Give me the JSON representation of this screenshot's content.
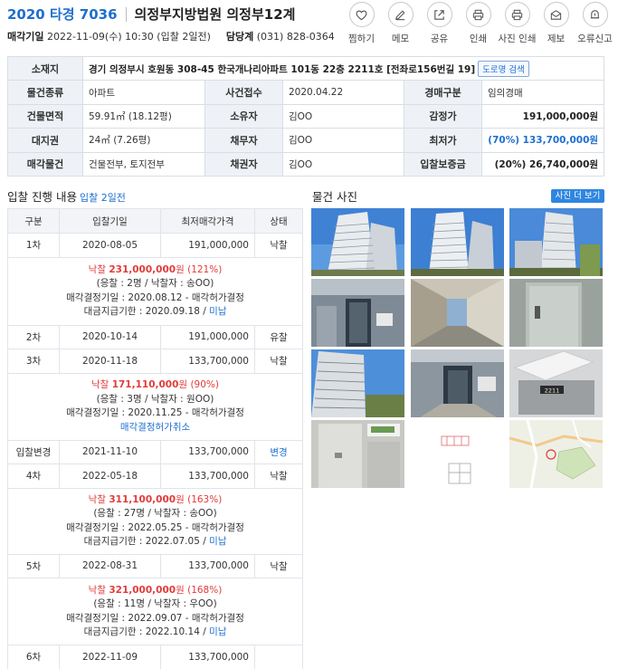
{
  "header": {
    "case_no": "2020 타경 7036",
    "court": "의정부지방법원 의정부12계",
    "date_label": "매각기일",
    "date_value": "2022-11-09(수) 10:30 (입찰 2일전)",
    "dept_label": "담당계",
    "dept_value": "(031) 828-0364"
  },
  "tools": [
    "찜하기",
    "메모",
    "공유",
    "인쇄",
    "사진 인쇄",
    "제보",
    "오류신고"
  ],
  "info": {
    "location_label": "소재지",
    "location_value": "경기 의정부시 호원동 308-45 한국개나리아파트 101동 22층 2211호 [전좌로156번길 19]",
    "road_btn": "도로명 검색",
    "type_label": "물건종류",
    "type_value": "아파트",
    "receipt_label": "사건접수",
    "receipt_value": "2020.04.22",
    "auction_type_label": "경매구분",
    "auction_type_value": "임의경매",
    "area_label": "건물면적",
    "area_value": "59.91㎡ (18.12평)",
    "owner_label": "소유자",
    "owner_value": "김OO",
    "appraisal_label": "감정가",
    "appraisal_value": "191,000,000원",
    "land_label": "대지권",
    "land_value": "24㎡ (7.26평)",
    "debtor_label": "채무자",
    "debtor_value": "김OO",
    "min_label": "최저가",
    "min_value": "(70%) 133,700,000원",
    "sale_label": "매각물건",
    "sale_value": "건물전부, 토지전부",
    "creditor_label": "채권자",
    "creditor_value": "김OO",
    "deposit_label": "입찰보증금",
    "deposit_value": "(20%) 26,740,000원"
  },
  "bid_section": {
    "title": "입찰 진행 내용",
    "sub": "입찰 2일전"
  },
  "bid_table": {
    "headers": [
      "구분",
      "입찰기일",
      "최저매각가격",
      "상태"
    ],
    "rows": [
      {
        "round": "1차",
        "date": "2020-08-05",
        "price": "191,000,000",
        "status": "낙찰"
      },
      {
        "round": "2차",
        "date": "2020-10-14",
        "price": "191,000,000",
        "status": "유찰"
      },
      {
        "round": "3차",
        "date": "2020-11-18",
        "price": "133,700,000",
        "status": "낙찰"
      },
      {
        "round": "입찰변경",
        "date": "2021-11-10",
        "price": "133,700,000",
        "status": "변경"
      },
      {
        "round": "4차",
        "date": "2022-05-18",
        "price": "133,700,000",
        "status": "낙찰"
      },
      {
        "round": "5차",
        "date": "2022-08-31",
        "price": "133,700,000",
        "status": "낙찰"
      },
      {
        "round": "6차",
        "date": "2022-11-09",
        "price": "133,700,000",
        "status": ""
      }
    ],
    "details": [
      {
        "prefix": "낙찰",
        "amount": "231,000,000",
        "won": "원",
        "rate": "(121%)",
        "bidders": "(응찰 : 2명 / 낙찰자 : 송OO)",
        "decision": "매각결정기일 : 2020.08.12 - 매각허가결정",
        "payment": "대금지급기한 : 2020.09.18 /",
        "pay_status": "미납"
      },
      {
        "prefix": "낙찰",
        "amount": "171,110,000",
        "won": "원",
        "rate": "(90%)",
        "bidders": "(응찰 : 3명 / 낙찰자 : 원OO)",
        "decision": "매각결정기일 : 2020.11.25 - 매각허가결정",
        "cancel": "매각결정허가취소"
      },
      {
        "prefix": "낙찰",
        "amount": "311,100,000",
        "won": "원",
        "rate": "(163%)",
        "bidders": "(응찰 : 27명 / 낙찰자 : 송OO)",
        "decision": "매각결정기일 : 2022.05.25 - 매각허가결정",
        "payment": "대금지급기한 : 2022.07.05 /",
        "pay_status": "미납"
      },
      {
        "prefix": "낙찰",
        "amount": "321,000,000",
        "won": "원",
        "rate": "(168%)",
        "bidders": "(응찰 : 11명 / 낙찰자 : 우OO)",
        "decision": "매각결정기일 : 2022.09.07 - 매각허가결정",
        "payment": "대금지급기한 : 2022.10.14 /",
        "pay_status": "미납"
      }
    ]
  },
  "photos": {
    "title": "물건 사진",
    "more_btn": "사진 더 보기",
    "door_sign": "2211"
  }
}
